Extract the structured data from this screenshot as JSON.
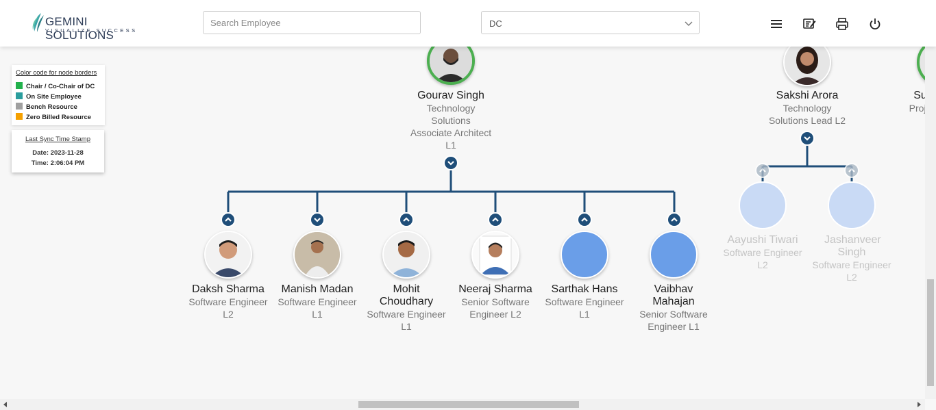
{
  "header": {
    "logo_main": "GEMINI SOLUTIONS",
    "logo_sub": "VISUALIZE SUCCESS",
    "search_placeholder": "Search Employee",
    "dc_value": "DC"
  },
  "legend": {
    "title": "Color code for node borders",
    "items": [
      {
        "label": "Chair / Co-Chair of DC",
        "color": "#22b14c"
      },
      {
        "label": "On Site Employee",
        "color": "#2a9d9d"
      },
      {
        "label": "Bench Resource",
        "color": "#a0a0a0"
      },
      {
        "label": "Zero Billed Resource",
        "color": "#f5a000"
      }
    ]
  },
  "sync": {
    "title": "Last Sync Time Stamp",
    "date": "Date: 2023-11-28",
    "time": "Time: 2:06:04 PM"
  },
  "colors": {
    "connector": "#1f4e79",
    "chair_border": "#4caf50",
    "placeholder_avatar": "#6a9ee8",
    "faded_avatar": "#c9daf5"
  },
  "parents": [
    {
      "name": "Gourav Singh",
      "desc": [
        "Technology",
        "Solutions",
        "Associate Architect",
        "L1"
      ]
    },
    {
      "name": "Sakshi Arora",
      "desc": [
        "Technology",
        "Solutions Lead L2"
      ]
    },
    {
      "name": "Su",
      "desc": [
        "Proje"
      ]
    }
  ],
  "children": [
    {
      "name": "Daksh Sharma",
      "desc": [
        "Software Engineer",
        "L2"
      ]
    },
    {
      "name": "Manish Madan",
      "desc": [
        "Software Engineer",
        "L1"
      ]
    },
    {
      "name": "Mohit Choudhary",
      "desc": [
        "Software Engineer",
        "L1"
      ]
    },
    {
      "name": "Neeraj Sharma",
      "desc": [
        "Senior Software",
        "Engineer L2"
      ]
    },
    {
      "name": "Sarthak Hans",
      "desc": [
        "Software Engineer",
        "L1"
      ]
    },
    {
      "name": "Vaibhav Mahajan",
      "desc": [
        "Senior Software",
        "Engineer L1"
      ]
    }
  ],
  "sakshi_children": [
    {
      "name": "Aayushi Tiwari",
      "desc": [
        "Software Engineer",
        "L2"
      ]
    },
    {
      "name": "Jashanveer Singh",
      "desc": [
        "Software Engineer",
        "L2"
      ]
    }
  ]
}
